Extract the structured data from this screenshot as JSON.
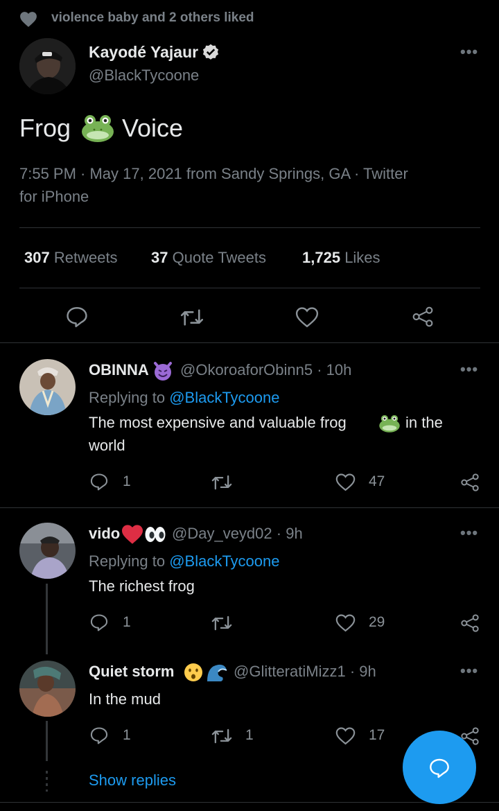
{
  "social_context": {
    "text": "violence baby and 2 others liked",
    "icon": "heart-icon"
  },
  "main_tweet": {
    "author_name": "Kayodé Yajaur",
    "author_handle": "@BlackTycoone",
    "verified": true,
    "text_before": "Frog",
    "emoji": "frog-face",
    "text_after": "Voice",
    "meta_line1": "7:55 PM · May 17, 2021 from Sandy Springs, GA · Twitter",
    "meta_line2": "for iPhone",
    "stats": {
      "retweets_count": "307",
      "retweets_label": "Retweets",
      "quotes_count": "37",
      "quotes_label": "Quote Tweets",
      "likes_count": "1,725",
      "likes_label": "Likes"
    }
  },
  "replies": [
    {
      "name": "OBINNA",
      "name_emoji": "smiling-devil",
      "handle": "@OkoroaforObinn5",
      "time": "· 10h",
      "replying_prefix": "Replying to ",
      "replying_to": "@BlackTycoone",
      "text_line1_a": "The most expensive and valuable frog",
      "text_line1_b": "in the",
      "text_line2": "world",
      "reply_count": "1",
      "retweet_count": "",
      "like_count": "47"
    },
    {
      "name": "vido",
      "name_emoji": "red-heart eyes",
      "handle": "@Day_veyd02",
      "time": "· 9h",
      "replying_prefix": "Replying to ",
      "replying_to": "@BlackTycoone",
      "text": "The richest frog",
      "reply_count": "1",
      "retweet_count": "",
      "like_count": "29"
    },
    {
      "name": "Quiet storm",
      "name_emoji": "hushed-face water-wave",
      "handle": "@GlitteratiMizz1",
      "time": "· 9h",
      "text": "In the mud",
      "reply_count": "1",
      "retweet_count": "1",
      "like_count": "17"
    }
  ],
  "show_replies": "Show replies",
  "colors": {
    "background": "#000000",
    "accent": "#1d9bf0",
    "muted": "#6e767d",
    "divider": "#2f3336",
    "frog": "#77b255"
  }
}
